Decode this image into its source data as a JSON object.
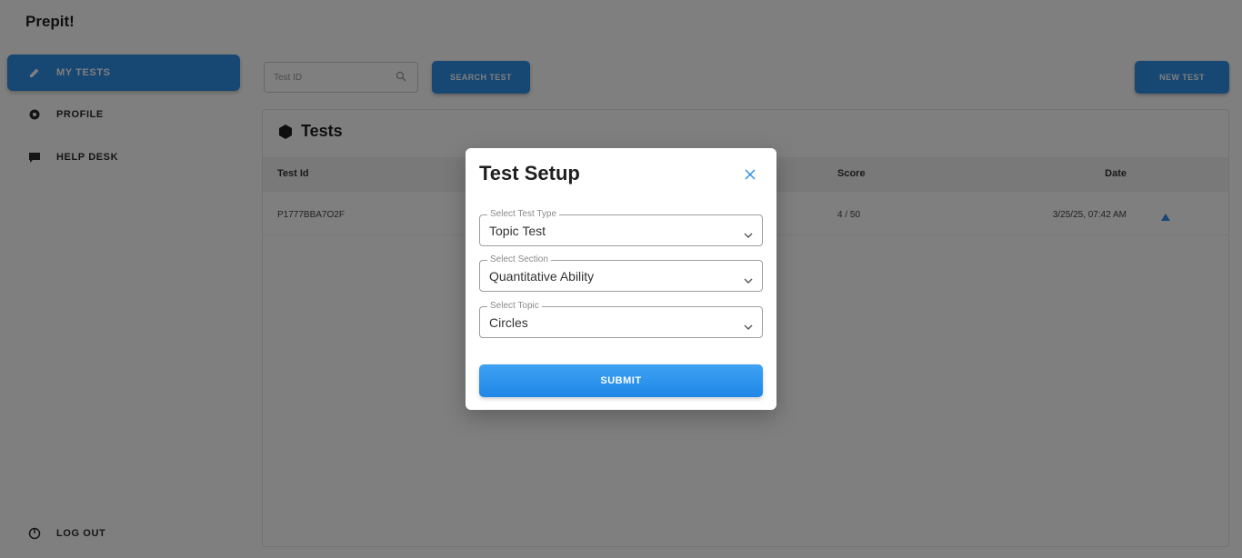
{
  "app": {
    "brand": "Prepit!",
    "sidebar": {
      "items": [
        {
          "label": "MY TESTS",
          "icon": "edit-icon",
          "active": true
        },
        {
          "label": "PROFILE",
          "icon": "settings-icon",
          "active": false
        },
        {
          "label": "HELP DESK",
          "icon": "chat-icon",
          "active": false
        }
      ],
      "logout_label": "LOG OUT"
    },
    "toolbar": {
      "search_placeholder": "Test ID",
      "search_button": "SEARCH TEST",
      "new_test_button": "NEW TEST"
    },
    "panel": {
      "title": "Tests",
      "columns": [
        "Test Id",
        "Score",
        "Date"
      ],
      "rows": [
        {
          "test_id": "P1777BBA7O2F",
          "score": "4 / 50",
          "date": "3/25/25, 07:42 AM"
        }
      ]
    }
  },
  "modal": {
    "title": "Test Setup",
    "fields": [
      {
        "legend": "Select Test Type",
        "value": "Topic Test"
      },
      {
        "legend": "Select Section",
        "value": "Quantitative Ability"
      },
      {
        "legend": "Select Topic",
        "value": "Circles"
      }
    ],
    "submit_label": "SUBMIT"
  },
  "colors": {
    "accent": "#2f8fe6",
    "close_icon": "#2f8fe6",
    "overlay": "rgba(0,0,0,0.5)"
  }
}
